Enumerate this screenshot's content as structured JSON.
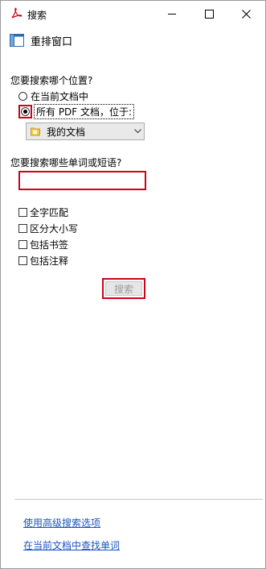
{
  "window": {
    "title": "搜索"
  },
  "toolbar": {
    "arrange_label": "重排窗口"
  },
  "location": {
    "question": "您要搜索哪个位置?",
    "option_current": "在当前文档中",
    "option_all_pdf": "所有 PDF 文档，位于:",
    "folder_value": "我的文档"
  },
  "query": {
    "question": "您要搜索哪些单词或短语?",
    "value": ""
  },
  "options": {
    "whole_word": "全字匹配",
    "case_sensitive": "区分大小写",
    "include_bookmarks": "包括书签",
    "include_comments": "包括注释"
  },
  "actions": {
    "search_label": "搜索"
  },
  "links": {
    "advanced": "使用高级搜索选项",
    "find_in_doc": "在当前文档中查找单词"
  },
  "colors": {
    "highlight": "#d0021b",
    "link": "#1a54c4"
  }
}
